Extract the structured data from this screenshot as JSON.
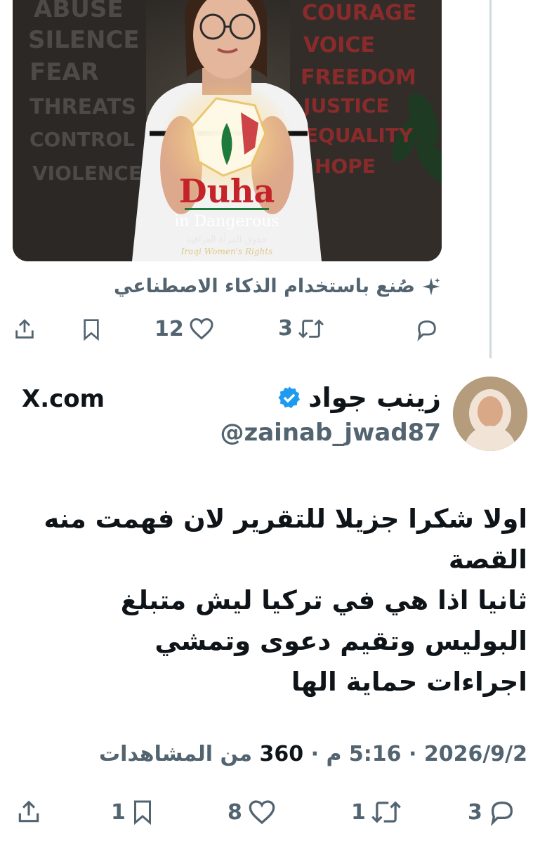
{
  "first_tweet": {
    "image": {
      "wall_left_words": [
        "ABUSE",
        "SILENCE",
        "FEAR",
        "THREATS",
        "CONTROL",
        "VIOLENCE"
      ],
      "wall_right_words": [
        "COURAGE",
        "VOICE",
        "FREEDOM",
        "JUSTICE",
        "EQUALITY",
        "HOPE"
      ],
      "logo_title": "Duha",
      "logo_subtitle": "in Dangerous",
      "logo_arabic": "حقوق المرأة العراقية",
      "logo_english": "Iraqi Women's Rights"
    },
    "ai_caption": "صُنع باستخدام الذكاء الاصطناعي",
    "actions": {
      "reply_count": "",
      "retweet_count": "3",
      "like_count": "12",
      "bookmark_count": "",
      "share_count": ""
    }
  },
  "second_tweet": {
    "display_name": "زينب جواد",
    "verified": true,
    "handle": "@zainab_jwad87",
    "brand": "X.com",
    "body_lines": [
      "اولا شكرا جزيلا للتقرير لان فهمت منه",
      "القصة",
      "ثانيا اذا هي في تركيا ليش متبلغ",
      "البوليس وتقيم دعوى وتمشي",
      "اجراءات حماية الها"
    ],
    "meta": {
      "date": "2026/9/2",
      "separator": "·",
      "time": "5:16 م",
      "views": "360",
      "views_label": "من المشاهدات"
    },
    "actions": {
      "reply_count": "3",
      "retweet_count": "1",
      "like_count": "8",
      "bookmark_count": "1",
      "share_count": ""
    }
  },
  "colors": {
    "text_primary": "#0f1419",
    "text_secondary": "#536471",
    "verified_blue": "#1d9bf0",
    "thread_line": "#cfd9de",
    "logo_red": "#c4232a",
    "logo_green": "#1e7a3b"
  }
}
